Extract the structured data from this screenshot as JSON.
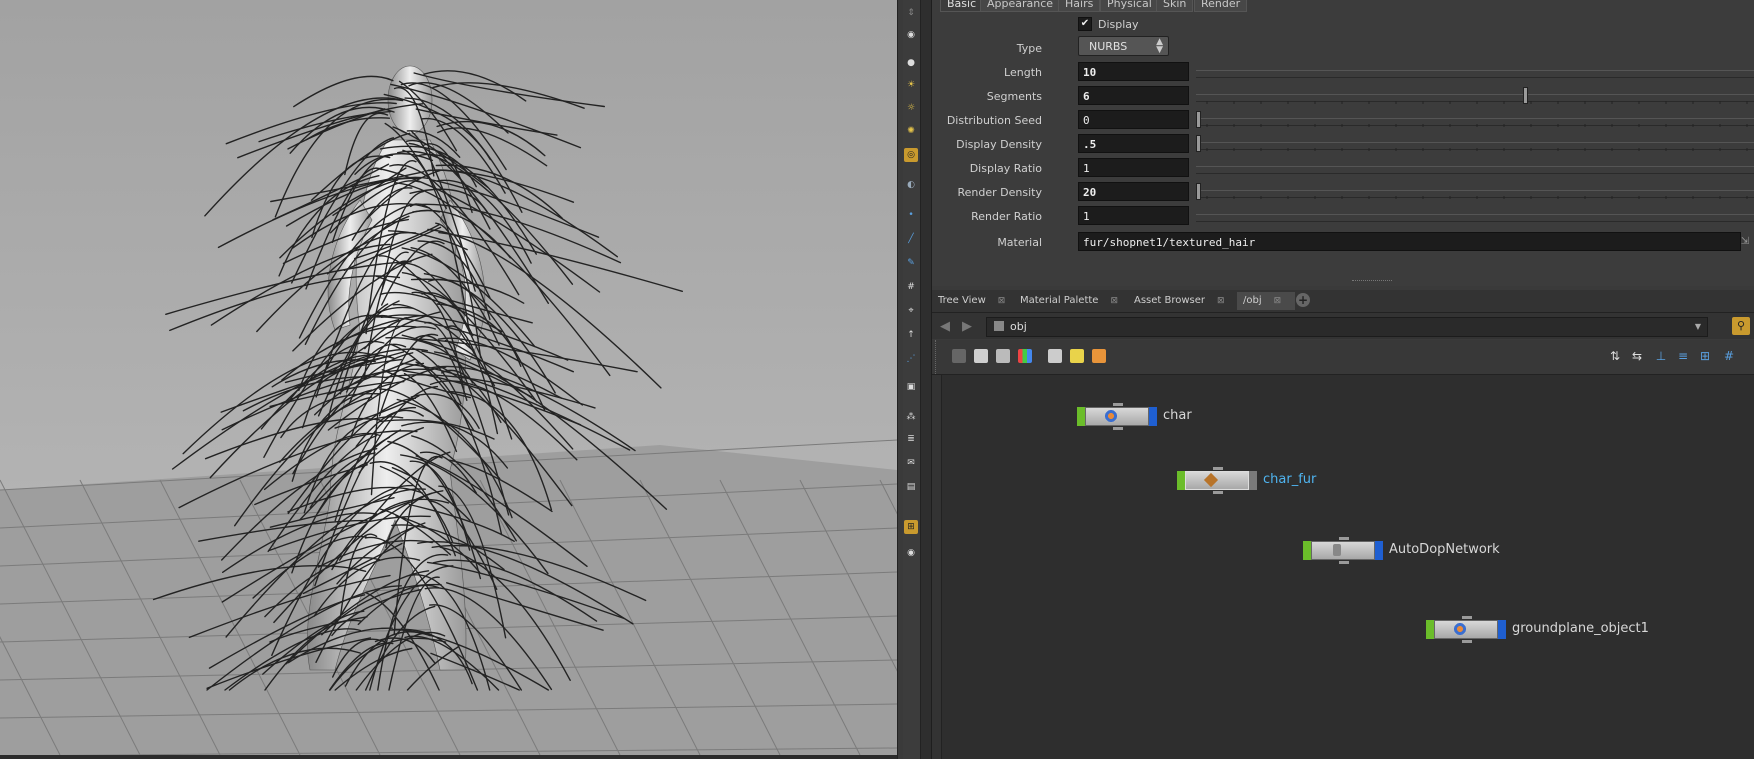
{
  "parameters": {
    "tabs": [
      "Basic",
      "Appearance",
      "Hairs",
      "Physical",
      "Skin",
      "Render"
    ],
    "active_tab": "Basic",
    "display": {
      "label": "Display",
      "checked": true,
      "check_glyph": "✔"
    },
    "type": {
      "label": "Type",
      "value": "NURBS"
    },
    "length": {
      "label": "Length",
      "value": "10"
    },
    "segments": {
      "label": "Segments",
      "value": "6"
    },
    "distribution_seed": {
      "label": "Distribution Seed",
      "value": "0"
    },
    "display_density": {
      "label": "Display Density",
      "value": ".5"
    },
    "display_ratio": {
      "label": "Display Ratio",
      "value": "1"
    },
    "render_density": {
      "label": "Render Density",
      "value": "20"
    },
    "render_ratio": {
      "label": "Render Ratio",
      "value": "1"
    },
    "material": {
      "label": "Material",
      "value": "fur/shopnet1/textured_hair"
    }
  },
  "pane_tabs": [
    {
      "label": "Tree View",
      "close": "⊠"
    },
    {
      "label": "Material Palette",
      "close": "⊠"
    },
    {
      "label": "Asset Browser",
      "close": "⊠"
    },
    {
      "label": "/obj",
      "close": "⊠"
    }
  ],
  "add_tab_glyph": "+",
  "path": {
    "value": "obj",
    "dropdown_glyph": "▼"
  },
  "nodes": [
    {
      "label": "char",
      "selected": false,
      "icon": "geometry-icon"
    },
    {
      "label": "char_fur",
      "selected": true,
      "icon": "fur-icon"
    },
    {
      "label": "AutoDopNetwork",
      "selected": false,
      "icon": "dop-network-icon"
    },
    {
      "label": "groundplane_object1",
      "selected": false,
      "icon": "geometry-icon"
    }
  ],
  "colors": {
    "accent_selected": "#4fb4f0",
    "display_flag": "#6bbd2a",
    "render_flag": "#1f5fd1",
    "viewport_bg": "#aaaaaa"
  }
}
